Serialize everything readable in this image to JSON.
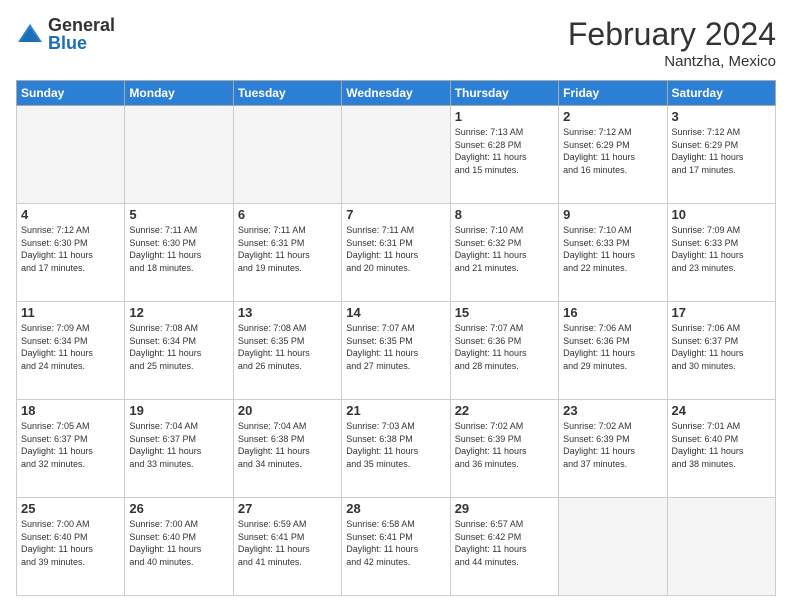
{
  "header": {
    "logo_general": "General",
    "logo_blue": "Blue",
    "month_title": "February 2024",
    "location": "Nantzha, Mexico"
  },
  "weekdays": [
    "Sunday",
    "Monday",
    "Tuesday",
    "Wednesday",
    "Thursday",
    "Friday",
    "Saturday"
  ],
  "weeks": [
    [
      {
        "day": "",
        "info": ""
      },
      {
        "day": "",
        "info": ""
      },
      {
        "day": "",
        "info": ""
      },
      {
        "day": "",
        "info": ""
      },
      {
        "day": "1",
        "info": "Sunrise: 7:13 AM\nSunset: 6:28 PM\nDaylight: 11 hours\nand 15 minutes."
      },
      {
        "day": "2",
        "info": "Sunrise: 7:12 AM\nSunset: 6:29 PM\nDaylight: 11 hours\nand 16 minutes."
      },
      {
        "day": "3",
        "info": "Sunrise: 7:12 AM\nSunset: 6:29 PM\nDaylight: 11 hours\nand 17 minutes."
      }
    ],
    [
      {
        "day": "4",
        "info": "Sunrise: 7:12 AM\nSunset: 6:30 PM\nDaylight: 11 hours\nand 17 minutes."
      },
      {
        "day": "5",
        "info": "Sunrise: 7:11 AM\nSunset: 6:30 PM\nDaylight: 11 hours\nand 18 minutes."
      },
      {
        "day": "6",
        "info": "Sunrise: 7:11 AM\nSunset: 6:31 PM\nDaylight: 11 hours\nand 19 minutes."
      },
      {
        "day": "7",
        "info": "Sunrise: 7:11 AM\nSunset: 6:31 PM\nDaylight: 11 hours\nand 20 minutes."
      },
      {
        "day": "8",
        "info": "Sunrise: 7:10 AM\nSunset: 6:32 PM\nDaylight: 11 hours\nand 21 minutes."
      },
      {
        "day": "9",
        "info": "Sunrise: 7:10 AM\nSunset: 6:33 PM\nDaylight: 11 hours\nand 22 minutes."
      },
      {
        "day": "10",
        "info": "Sunrise: 7:09 AM\nSunset: 6:33 PM\nDaylight: 11 hours\nand 23 minutes."
      }
    ],
    [
      {
        "day": "11",
        "info": "Sunrise: 7:09 AM\nSunset: 6:34 PM\nDaylight: 11 hours\nand 24 minutes."
      },
      {
        "day": "12",
        "info": "Sunrise: 7:08 AM\nSunset: 6:34 PM\nDaylight: 11 hours\nand 25 minutes."
      },
      {
        "day": "13",
        "info": "Sunrise: 7:08 AM\nSunset: 6:35 PM\nDaylight: 11 hours\nand 26 minutes."
      },
      {
        "day": "14",
        "info": "Sunrise: 7:07 AM\nSunset: 6:35 PM\nDaylight: 11 hours\nand 27 minutes."
      },
      {
        "day": "15",
        "info": "Sunrise: 7:07 AM\nSunset: 6:36 PM\nDaylight: 11 hours\nand 28 minutes."
      },
      {
        "day": "16",
        "info": "Sunrise: 7:06 AM\nSunset: 6:36 PM\nDaylight: 11 hours\nand 29 minutes."
      },
      {
        "day": "17",
        "info": "Sunrise: 7:06 AM\nSunset: 6:37 PM\nDaylight: 11 hours\nand 30 minutes."
      }
    ],
    [
      {
        "day": "18",
        "info": "Sunrise: 7:05 AM\nSunset: 6:37 PM\nDaylight: 11 hours\nand 32 minutes."
      },
      {
        "day": "19",
        "info": "Sunrise: 7:04 AM\nSunset: 6:37 PM\nDaylight: 11 hours\nand 33 minutes."
      },
      {
        "day": "20",
        "info": "Sunrise: 7:04 AM\nSunset: 6:38 PM\nDaylight: 11 hours\nand 34 minutes."
      },
      {
        "day": "21",
        "info": "Sunrise: 7:03 AM\nSunset: 6:38 PM\nDaylight: 11 hours\nand 35 minutes."
      },
      {
        "day": "22",
        "info": "Sunrise: 7:02 AM\nSunset: 6:39 PM\nDaylight: 11 hours\nand 36 minutes."
      },
      {
        "day": "23",
        "info": "Sunrise: 7:02 AM\nSunset: 6:39 PM\nDaylight: 11 hours\nand 37 minutes."
      },
      {
        "day": "24",
        "info": "Sunrise: 7:01 AM\nSunset: 6:40 PM\nDaylight: 11 hours\nand 38 minutes."
      }
    ],
    [
      {
        "day": "25",
        "info": "Sunrise: 7:00 AM\nSunset: 6:40 PM\nDaylight: 11 hours\nand 39 minutes."
      },
      {
        "day": "26",
        "info": "Sunrise: 7:00 AM\nSunset: 6:40 PM\nDaylight: 11 hours\nand 40 minutes."
      },
      {
        "day": "27",
        "info": "Sunrise: 6:59 AM\nSunset: 6:41 PM\nDaylight: 11 hours\nand 41 minutes."
      },
      {
        "day": "28",
        "info": "Sunrise: 6:58 AM\nSunset: 6:41 PM\nDaylight: 11 hours\nand 42 minutes."
      },
      {
        "day": "29",
        "info": "Sunrise: 6:57 AM\nSunset: 6:42 PM\nDaylight: 11 hours\nand 44 minutes."
      },
      {
        "day": "",
        "info": ""
      },
      {
        "day": "",
        "info": ""
      }
    ]
  ]
}
